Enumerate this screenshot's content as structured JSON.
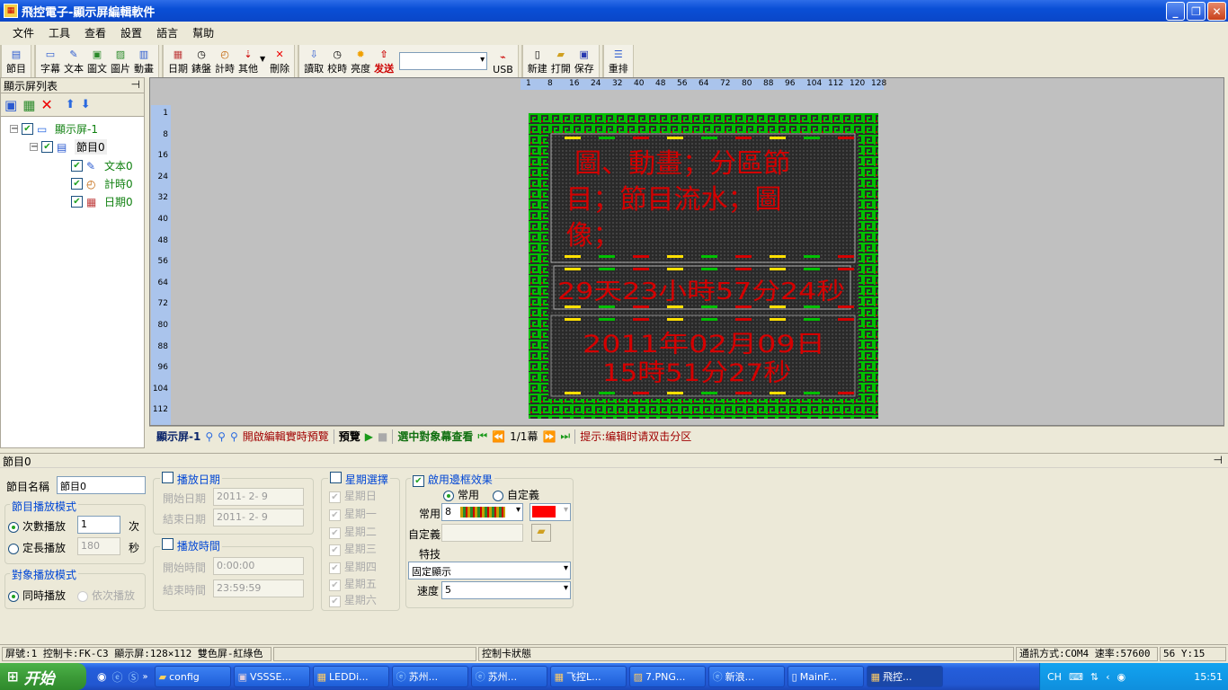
{
  "window": {
    "title": "飛控電子-顯示屏編輯軟件"
  },
  "menu": [
    "文件",
    "工具",
    "查看",
    "設置",
    "語言",
    "幫助"
  ],
  "toolbar": {
    "group1": [
      {
        "label": "節目",
        "icon": "program-icon"
      }
    ],
    "group2": [
      {
        "label": "字幕",
        "icon": "caption-icon"
      },
      {
        "label": "文本",
        "icon": "text-icon"
      },
      {
        "label": "圖文",
        "icon": "picture-text-icon"
      },
      {
        "label": "圖片",
        "icon": "picture-icon"
      },
      {
        "label": "動畫",
        "icon": "animation-icon"
      }
    ],
    "group3": [
      {
        "label": "日期",
        "icon": "calendar-icon"
      },
      {
        "label": "錶盤",
        "icon": "clock-icon"
      },
      {
        "label": "計時",
        "icon": "timer-icon"
      },
      {
        "label": "其他",
        "icon": "other-icon"
      },
      {
        "label": "刪除",
        "icon": "delete-icon"
      }
    ],
    "group4": [
      {
        "label": "讀取",
        "icon": "read-icon"
      },
      {
        "label": "校時",
        "icon": "sync-time-icon"
      },
      {
        "label": "亮度",
        "icon": "brightness-icon"
      },
      {
        "label": "发送",
        "icon": "send-icon"
      }
    ],
    "usb_label": "USB",
    "group5": [
      {
        "label": "新建",
        "icon": "new-file-icon"
      },
      {
        "label": "打開",
        "icon": "open-folder-icon"
      },
      {
        "label": "保存",
        "icon": "save-icon"
      }
    ],
    "group6": [
      {
        "label": "重排",
        "icon": "rearrange-icon"
      }
    ]
  },
  "left_panel": {
    "title": "顯示屏列表",
    "pin": "ᗒ",
    "tree": {
      "screen": "顯示屏-1",
      "program": "節目0",
      "items": [
        "文本0",
        "計時0",
        "日期0"
      ]
    }
  },
  "ruler": {
    "h_ticks": [
      "1",
      "8",
      "16",
      "24",
      "32",
      "40",
      "48",
      "56",
      "64",
      "72",
      "80",
      "88",
      "96",
      "104",
      "112",
      "120",
      "128"
    ],
    "v_ticks": [
      "1",
      "8",
      "16",
      "24",
      "32",
      "40",
      "48",
      "56",
      "64",
      "72",
      "80",
      "88",
      "96",
      "104",
      "112"
    ]
  },
  "led_screen": {
    "text_area": [
      "  圖、動畫；分區節",
      " 目；節目流水；圖",
      " 像；"
    ],
    "timer_text": "29天23小時57分24秒",
    "date_line1": "2011年02月09日",
    "date_line2": "15時51分27秒"
  },
  "canvas_bar": {
    "screen_name": "顯示屏-1",
    "realtime_preview": "開啟編輯實時預覽",
    "preview": "預覽",
    "select_view": "選中對象幕查看",
    "page": "1/1幕",
    "hint": "提示:编辑时请双击分区"
  },
  "props": {
    "title": "節目0",
    "name_label": "節目名稱",
    "name_value": "節目0",
    "play_mode_title": "節目播放模式",
    "count_play": "次數播放",
    "count_value": "1",
    "count_unit": "次",
    "fixed_len": "定長播放",
    "fixed_value": "180",
    "fixed_unit": "秒",
    "object_mode_title": "對象播放模式",
    "sync_play": "同時播放",
    "seq_play": "依次播放",
    "play_date_title": "播放日期",
    "start_date_label": "開始日期",
    "start_date": "2011- 2- 9",
    "end_date_label": "結束日期",
    "end_date": "2011- 2- 9",
    "play_time_title": "播放時間",
    "start_time_label": "開始時間",
    "start_time": "0:00:00",
    "end_time_label": "結束時間",
    "end_time": "23:59:59",
    "week_title": "星期選擇",
    "weekdays": [
      "星期日",
      "星期一",
      "星期二",
      "星期三",
      "星期四",
      "星期五",
      "星期六"
    ],
    "border_title": "啟用邊框效果",
    "border_common": "常用",
    "border_custom": "自定義",
    "common_label": "常用",
    "common_value": "8",
    "custom_label": "自定義",
    "effect_label": "特技",
    "effect_value": "固定顯示",
    "speed_label": "速度",
    "speed_value": "5"
  },
  "statusbar": {
    "screen_info": "屏號:1 控制卡:FK-C3 顯示屏:128×112 雙色屏-紅綠色",
    "card_status": "控制卡狀態",
    "comm": "通訊方式:COM4 速率:57600",
    "coords": "56 Y:15"
  },
  "taskbar": {
    "start": "开始",
    "tasks": [
      {
        "label": "config",
        "icon": "folder-icon"
      },
      {
        "label": "VSSSE...",
        "icon": "vs-icon"
      },
      {
        "label": "LEDDi...",
        "icon": "led-app-icon"
      },
      {
        "label": "苏州...",
        "icon": "ie-icon"
      },
      {
        "label": "苏州...",
        "icon": "ie-icon"
      },
      {
        "label": "飞控L...",
        "icon": "led-app-icon"
      },
      {
        "label": "7.PNG...",
        "icon": "image-viewer-icon"
      },
      {
        "label": "新浪...",
        "icon": "ie-icon"
      },
      {
        "label": "MainF...",
        "icon": "document-icon"
      },
      {
        "label": "飛控...",
        "icon": "led-app-icon"
      }
    ],
    "tray_lang": "CH",
    "clock": "15:51"
  },
  "colors": {
    "title_blue": "#0a4fd6",
    "led_red": "#d40000",
    "led_green": "#00c000",
    "led_yellow": "#ffe000",
    "status_red_label": "#c00000"
  }
}
